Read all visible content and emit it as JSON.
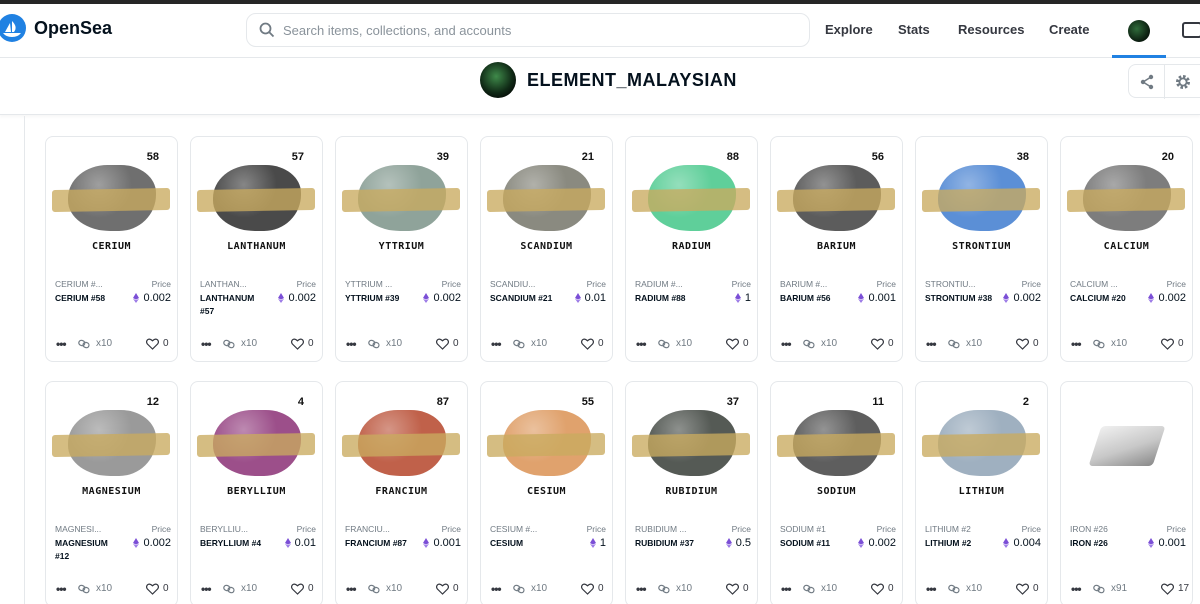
{
  "app": {
    "name": "OpenSea"
  },
  "search": {
    "placeholder": "Search items, collections, and accounts"
  },
  "nav": {
    "explore": "Explore",
    "stats": "Stats",
    "resources": "Resources",
    "create": "Create"
  },
  "collection": {
    "title": "ELEMENT_MALAYSIAN"
  },
  "colors": {
    "brand": "#2081e2",
    "tape": "#c9aa5f",
    "eth": "#7b4fd6"
  },
  "card_common": {
    "price_label": "Price",
    "more": "•••"
  },
  "cards": [
    {
      "number": "58",
      "label": "CERIUM",
      "name_short": "CERIUM #...",
      "name_full": "CERIUM #58",
      "price": "0.002",
      "qty": "x10",
      "likes": "0",
      "rock": "#6f6f6f"
    },
    {
      "number": "57",
      "label": "LANTHANUM",
      "name_short": "LANTHAN...",
      "name_full": "LANTHANUM #57",
      "price": "0.002",
      "qty": "x10",
      "likes": "0",
      "rock": "#4a4a4a"
    },
    {
      "number": "39",
      "label": "YTTRIUM",
      "name_short": "YTTRIUM ...",
      "name_full": "YTTRIUM #39",
      "price": "0.002",
      "qty": "x10",
      "likes": "0",
      "rock": "#8fa39a"
    },
    {
      "number": "21",
      "label": "SCANDIUM",
      "name_short": "SCANDIU...",
      "name_full": "SCANDIUM #21",
      "price": "0.01",
      "qty": "x10",
      "likes": "0",
      "rock": "#8a8a80"
    },
    {
      "number": "88",
      "label": "RADIUM",
      "name_short": "RADIUM #...",
      "name_full": "RADIUM #88",
      "price": "1",
      "qty": "x10",
      "likes": "0",
      "rock": "#5fcf9a"
    },
    {
      "number": "56",
      "label": "BARIUM",
      "name_short": "BARIUM #...",
      "name_full": "BARIUM #56",
      "price": "0.001",
      "qty": "x10",
      "likes": "0",
      "rock": "#5c5c5c"
    },
    {
      "number": "38",
      "label": "STRONTIUM",
      "name_short": "STRONTIU...",
      "name_full": "STRONTIUM #38",
      "price": "0.002",
      "qty": "x10",
      "likes": "0",
      "rock": "#5b8fd6"
    },
    {
      "number": "20",
      "label": "CALCIUM",
      "name_short": "CALCIUM ...",
      "name_full": "CALCIUM #20",
      "price": "0.002",
      "qty": "x10",
      "likes": "0",
      "rock": "#7d7d7d"
    },
    {
      "number": "12",
      "label": "MAGNESIUM",
      "name_short": "MAGNESI...",
      "name_full": "MAGNESIUM #12",
      "price": "0.002",
      "qty": "x10",
      "likes": "0",
      "rock": "#9a9a9a"
    },
    {
      "number": "4",
      "label": "BERYLLIUM",
      "name_short": "BERYLLIU...",
      "name_full": "BERYLLIUM #4",
      "price": "0.01",
      "qty": "x10",
      "likes": "0",
      "rock": "#9c4f8a"
    },
    {
      "number": "87",
      "label": "FRANCIUM",
      "name_short": "FRANCIU...",
      "name_full": "FRANCIUM #87",
      "price": "0.001",
      "qty": "x10",
      "likes": "0",
      "rock": "#c0614a"
    },
    {
      "number": "55",
      "label": "CESIUM",
      "name_short": "CESIUM #...",
      "name_full": "CESIUM",
      "price": "1",
      "qty": "x10",
      "likes": "0",
      "rock": "#e0a26d"
    },
    {
      "number": "37",
      "label": "RUBIDIUM",
      "name_short": "RUBIDIUM ...",
      "name_full": "RUBIDIUM #37",
      "price": "0.5",
      "qty": "x10",
      "likes": "0",
      "rock": "#555a55"
    },
    {
      "number": "11",
      "label": "SODIUM",
      "name_short": "SODIUM #1",
      "name_full": "SODIUM #11",
      "price": "0.002",
      "qty": "x10",
      "likes": "0",
      "rock": "#5e5e5e"
    },
    {
      "number": "2",
      "label": "LITHIUM",
      "name_short": "LITHIUM #2",
      "name_full": "LITHIUM #2",
      "price": "0.004",
      "qty": "x10",
      "likes": "0",
      "rock": "#9fb0c0"
    },
    {
      "number": "",
      "label": "",
      "name_short": "IRON #26",
      "name_full": "IRON #26",
      "price": "0.001",
      "qty": "x91",
      "likes": "17",
      "rock": "#c8c8c8"
    }
  ]
}
